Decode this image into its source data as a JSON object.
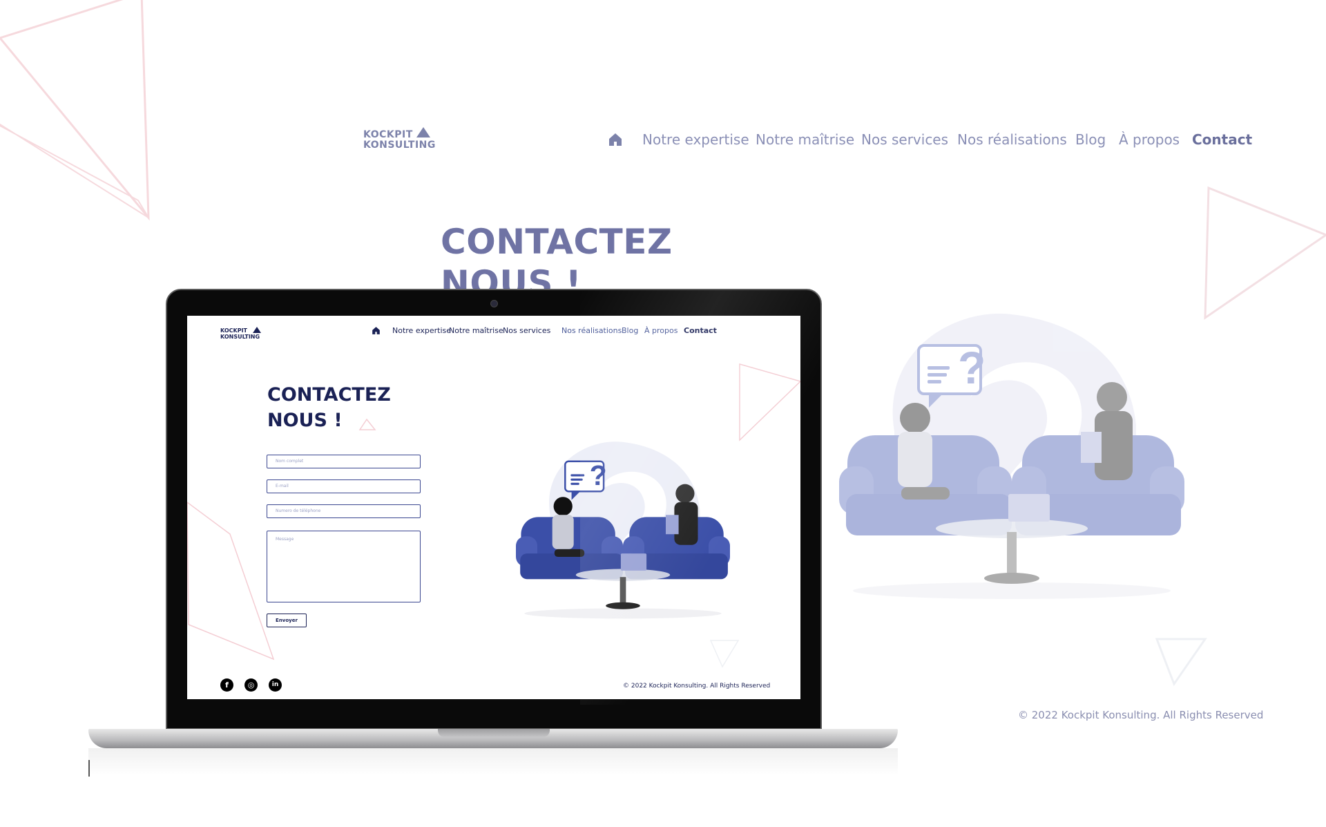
{
  "background": {
    "logo": {
      "line1": "KOCKPIT",
      "line2": "KONSULTING"
    },
    "nav": {
      "items": [
        "Notre expertise",
        "Notre maîtrise",
        "Nos services",
        "Nos réalisations",
        "Blog",
        "À propos",
        "Contact"
      ],
      "active": "Contact"
    },
    "title": {
      "line1": "CONTACTEZ",
      "line2": "NOUS !"
    },
    "footer": "© 2022 Kockpit Konsulting. All Rights Reserved"
  },
  "screen": {
    "logo": {
      "line1": "KOCKPIT",
      "line2": "KONSULTING"
    },
    "nav": {
      "items": [
        "Notre expertise",
        "Notre maîtrise",
        "Nos services",
        "Nos réalisations",
        "Blog",
        "À propos",
        "Contact"
      ],
      "active": "Contact"
    },
    "title": {
      "line1": "CONTACTEZ",
      "line2": "NOUS !"
    },
    "form": {
      "name_placeholder": "Nom complet",
      "email_placeholder": "E-mail",
      "phone_placeholder": "Numero de téléphone",
      "message_placeholder": "Message",
      "submit_label": "Envoyer"
    },
    "social": {
      "facebook": "f",
      "instagram": "◎",
      "linkedin": "in"
    },
    "footer": "© 2022 Kockpit Konsulting. All Rights Reserved"
  },
  "colors": {
    "brand_navy": "#1a2155",
    "brand_muted": "#7c82aa",
    "illustration_blue": "#3b4fa8",
    "accent_pink": "#f2c7cd"
  },
  "icons": [
    "home-icon",
    "facebook-icon",
    "instagram-icon",
    "linkedin-icon",
    "logo-triangle-icon"
  ]
}
